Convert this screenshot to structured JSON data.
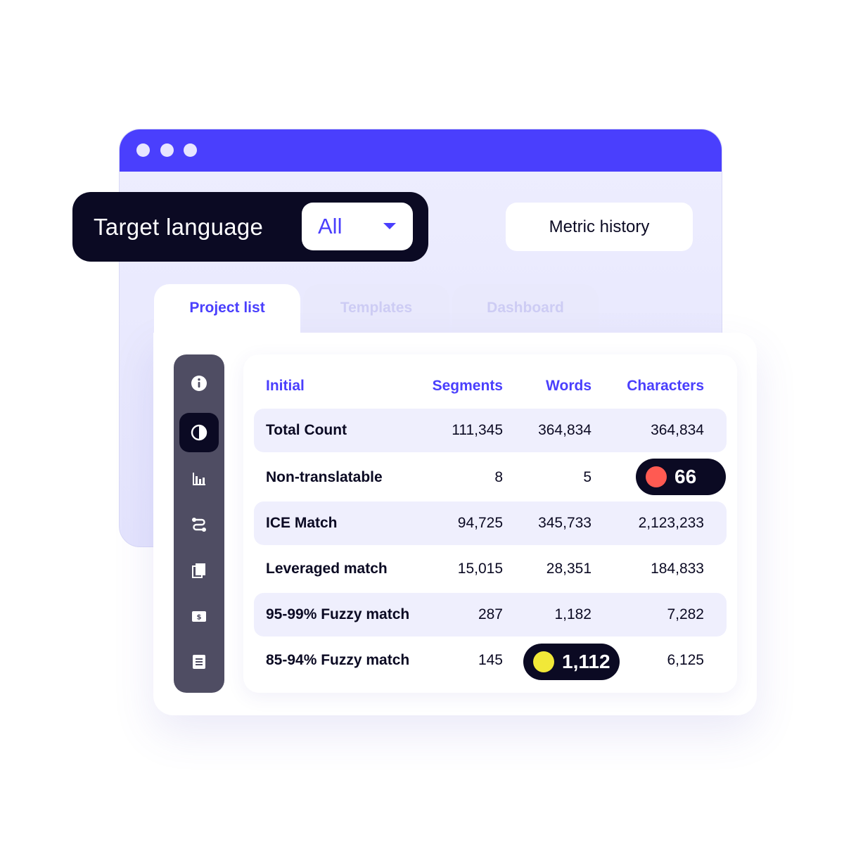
{
  "filter": {
    "label": "Target language",
    "selected": "All"
  },
  "metric_history_label": "Metric history",
  "tabs": [
    {
      "label": "Project list",
      "active": true
    },
    {
      "label": "Templates",
      "active": false
    },
    {
      "label": "Dashboard",
      "active": false
    }
  ],
  "sidebar": {
    "icons": [
      "info-icon",
      "pie-chart-icon",
      "bar-chart-icon",
      "workflow-icon",
      "documents-icon",
      "billing-icon",
      "notes-icon"
    ],
    "active": "pie-chart-icon"
  },
  "table": {
    "headers": [
      "Initial",
      "Segments",
      "Words",
      "Characters"
    ],
    "rows": [
      {
        "label": "Total Count",
        "segments": "111,345",
        "words": "364,834",
        "characters": "364,834"
      },
      {
        "label": "Non-translatable",
        "segments": "8",
        "words": "5",
        "characters": "66"
      },
      {
        "label": "ICE Match",
        "segments": "94,725",
        "words": "345,733",
        "characters": "2,123,233"
      },
      {
        "label": "Leveraged match",
        "segments": "15,015",
        "words": "28,351",
        "characters": "184,833"
      },
      {
        "label": "95-99% Fuzzy match",
        "segments": "287",
        "words": "1,182",
        "characters": "7,282"
      },
      {
        "label": "85-94% Fuzzy match",
        "segments": "145",
        "words": "1,112",
        "characters": "6,125"
      }
    ]
  },
  "highlights": {
    "red_dot_color": "#ff5a52",
    "yellow_dot_color": "#f1e838"
  },
  "colors": {
    "accent": "#4a3ffd",
    "dark": "#0b0a23"
  }
}
